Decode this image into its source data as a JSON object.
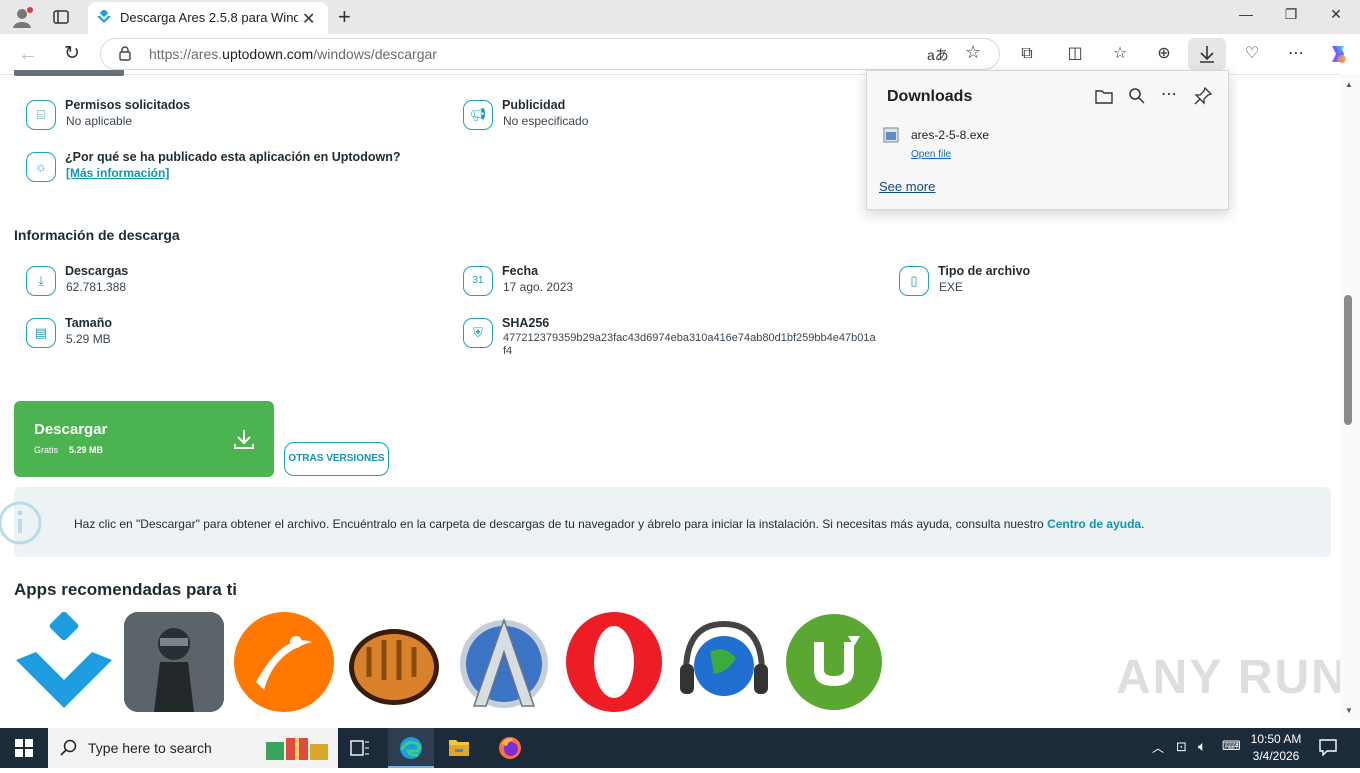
{
  "browser": {
    "tab_title": "Descarga Ares 2.5.8 para Window",
    "url_prefix": "https://ares.",
    "url_domain": "uptodown.com",
    "url_path": "/windows/descargar",
    "translate_glyph": "aあ"
  },
  "details": {
    "permisos_label": "Permisos solicitados",
    "permisos_value": "No aplicable",
    "publicidad_label": "Publicidad",
    "publicidad_value": "No especificado",
    "why_label": "¿Por qué se ha publicado esta aplicación en Uptodown?",
    "why_link": "[Más información]"
  },
  "download_info": {
    "heading": "Información de descarga",
    "descargas_label": "Descargas",
    "descargas_value": "62.781.388",
    "fecha_label": "Fecha",
    "fecha_value": "17 ago. 2023",
    "tipo_label": "Tipo de archivo",
    "tipo_value": "EXE",
    "tamano_label": "Tamaño",
    "tamano_value": "5.29 MB",
    "sha_label": "SHA256",
    "sha_value_1": "477212379359b29a23fac43d6974eba310a416e74ab80d1bf259bb4e47b01a",
    "sha_value_2": "f4",
    "fecha_icon_text": "31"
  },
  "actions": {
    "download_title": "Descargar",
    "download_free": "Gratis",
    "download_size": "5.29 MB",
    "other_versions": "OTRAS VERSIONES"
  },
  "notice": {
    "text": "Haz clic en \"Descargar\" para obtener el archivo. Encuéntralo en la carpeta de descargas de tu navegador y ábrelo para iniciar la instalación. Si necesitas más ayuda, consulta nuestro ",
    "link": "Centro de ayuda",
    "end": "."
  },
  "recommended": {
    "heading": "Apps recomendadas para ti",
    "apps": [
      "Uptodown",
      "PUBG",
      "Avast",
      "CatchIt",
      "Azureus",
      "Opera",
      "Radio",
      "uTorrent"
    ]
  },
  "downloads_panel": {
    "title": "Downloads",
    "file_name": "ares-2-5-8.exe",
    "open_file": "Open file",
    "see_more": "See more"
  },
  "taskbar": {
    "search_placeholder": "Type here to search",
    "time": "10:50 AM",
    "date": "3/4/2026"
  },
  "watermark": "ANY RUN",
  "colors": {
    "accent": "#1ea0b8",
    "download_green": "#4bb350",
    "taskbar": "#1c2b3a"
  }
}
